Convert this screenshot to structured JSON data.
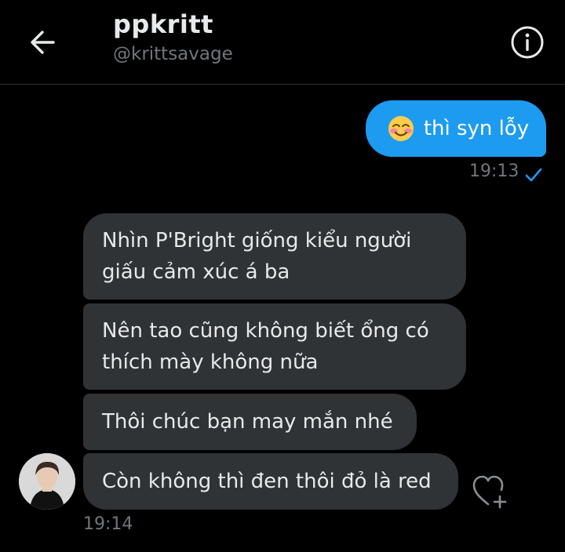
{
  "header": {
    "title": "ppkritt",
    "handle": "@krittsavage",
    "back_icon": "arrow-left-icon",
    "info_icon": "info-circle-icon"
  },
  "messages": {
    "sent": [
      {
        "emoji": "smiling-face-with-blush",
        "text": "thì syn lỗy",
        "time": "19:13",
        "status_icon": "check-icon"
      }
    ],
    "received": [
      {
        "text": "Nhìn P'Bright giống kiểu người giấu cảm xúc á ba"
      },
      {
        "text": "Nên tao cũng không biết ổng có thích mày không nữa"
      },
      {
        "text": "Thôi chúc bạn may mắn nhé"
      },
      {
        "text": "Còn không thì đen thôi đỏ là red"
      }
    ],
    "received_time": "19:14",
    "react_icon": "heart-plus-icon"
  },
  "colors": {
    "background": "#000000",
    "sent_bubble": "#1d9bf0",
    "received_bubble": "#2f3336",
    "muted_text": "#71767b",
    "accent": "#1d9bf0"
  }
}
